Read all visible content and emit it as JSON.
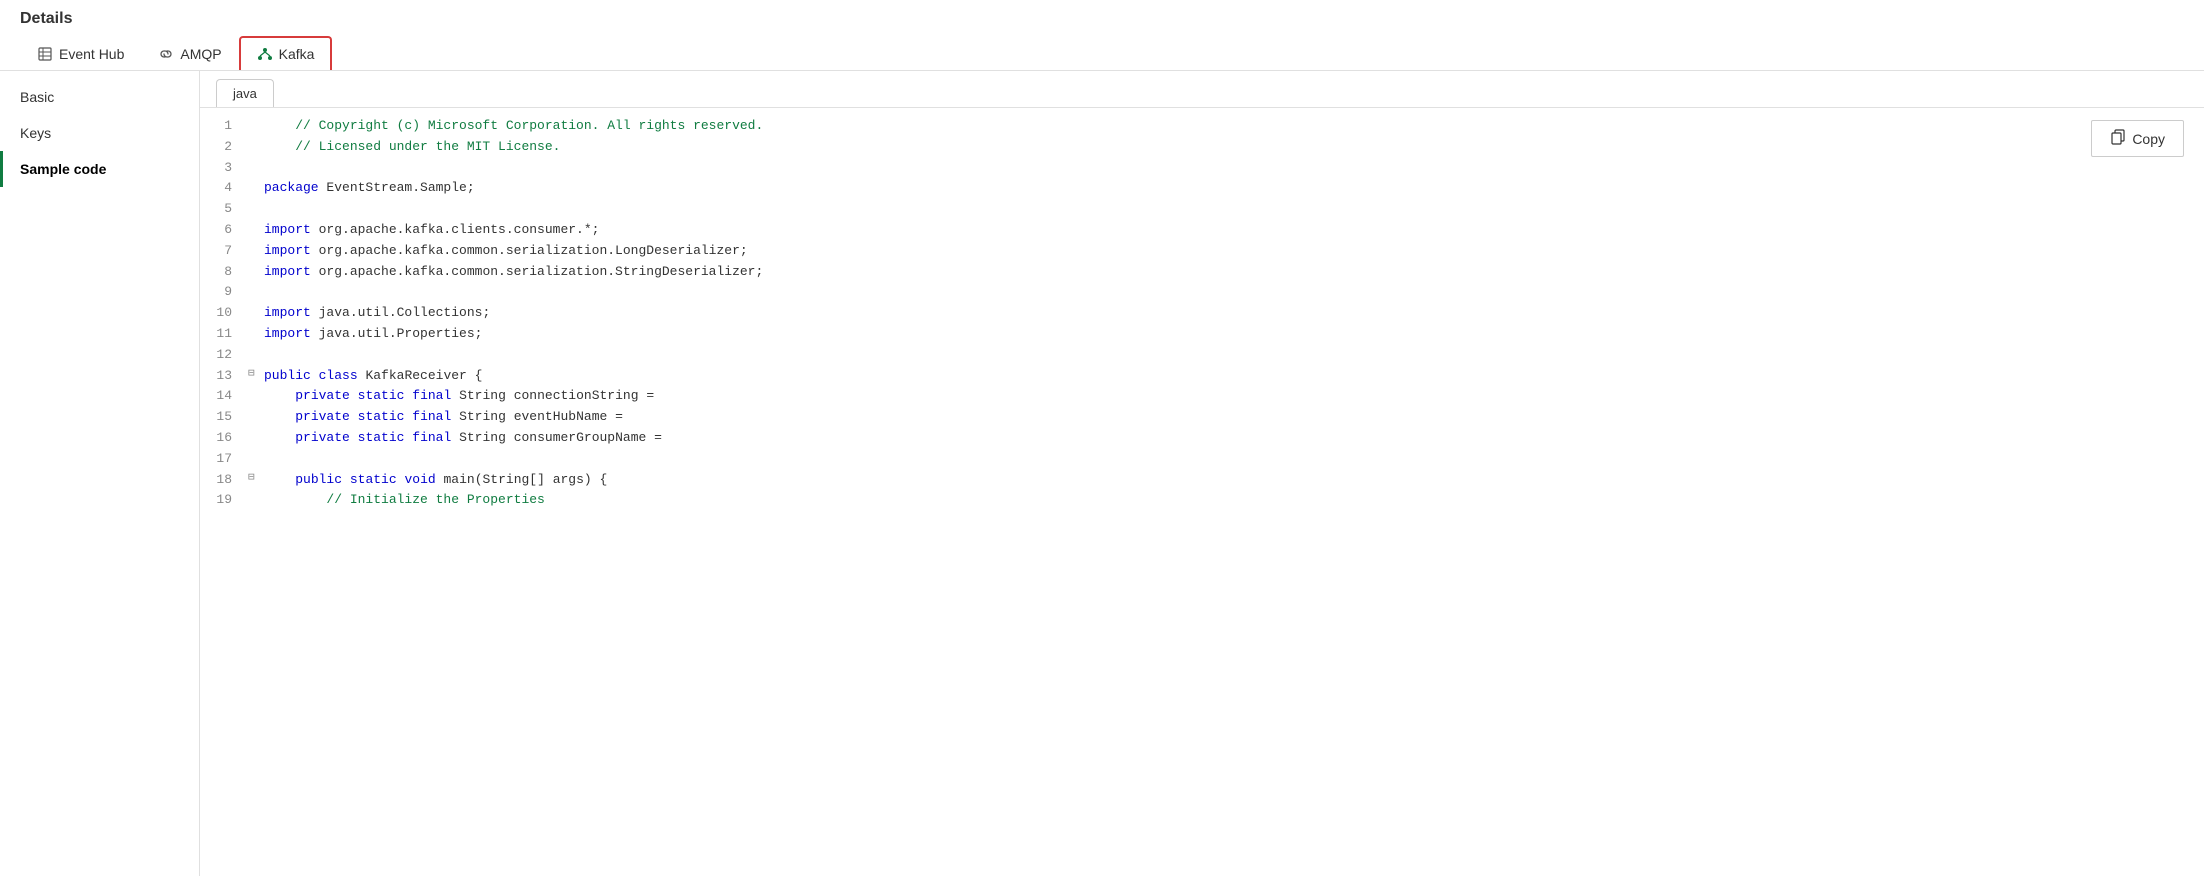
{
  "title": "Details",
  "tabs": [
    {
      "id": "event-hub",
      "label": "Event Hub",
      "icon": "table-icon",
      "active": false
    },
    {
      "id": "amqp",
      "label": "AMQP",
      "icon": "link-icon",
      "active": false
    },
    {
      "id": "kafka",
      "label": "Kafka",
      "icon": "kafka-icon",
      "active": true
    }
  ],
  "sidebar": {
    "items": [
      {
        "id": "basic",
        "label": "Basic",
        "active": false
      },
      {
        "id": "keys",
        "label": "Keys",
        "active": false
      },
      {
        "id": "sample-code",
        "label": "Sample code",
        "active": true
      }
    ]
  },
  "language_tabs": [
    {
      "id": "java",
      "label": "java",
      "active": true
    }
  ],
  "copy_button": "Copy",
  "code_lines": [
    {
      "num": 1,
      "content": "    // Copyright (c) Microsoft Corporation. All rights reserved.",
      "type": "comment"
    },
    {
      "num": 2,
      "content": "    // Licensed under the MIT License.",
      "type": "comment"
    },
    {
      "num": 3,
      "content": "",
      "type": "normal"
    },
    {
      "num": 4,
      "content": "    package EventStream.Sample;",
      "type": "mixed",
      "parts": [
        {
          "text": "    ",
          "class": ""
        },
        {
          "text": "package",
          "class": "kw-blue"
        },
        {
          "text": " EventStream.Sample;",
          "class": ""
        }
      ]
    },
    {
      "num": 5,
      "content": "",
      "type": "normal"
    },
    {
      "num": 6,
      "content": "    import org.apache.kafka.clients.consumer.*;",
      "type": "mixed",
      "parts": [
        {
          "text": "    ",
          "class": ""
        },
        {
          "text": "import",
          "class": "kw-blue"
        },
        {
          "text": " org.apache.kafka.clients.consumer.*;",
          "class": ""
        }
      ]
    },
    {
      "num": 7,
      "content": "    import org.apache.kafka.common.serialization.LongDeserializer;",
      "type": "mixed",
      "parts": [
        {
          "text": "    ",
          "class": ""
        },
        {
          "text": "import",
          "class": "kw-blue"
        },
        {
          "text": " org.apache.kafka.common.serialization.LongDeserializer;",
          "class": ""
        }
      ]
    },
    {
      "num": 8,
      "content": "    import org.apache.kafka.common.serialization.StringDeserializer;",
      "type": "mixed",
      "parts": [
        {
          "text": "    ",
          "class": ""
        },
        {
          "text": "import",
          "class": "kw-blue"
        },
        {
          "text": " org.apache.kafka.common.serialization.StringDeserializer;",
          "class": ""
        }
      ]
    },
    {
      "num": 9,
      "content": "",
      "type": "normal"
    },
    {
      "num": 10,
      "content": "    import java.util.Collections;",
      "type": "mixed",
      "parts": [
        {
          "text": "    ",
          "class": ""
        },
        {
          "text": "import",
          "class": "kw-blue"
        },
        {
          "text": " java.util.Collections;",
          "class": ""
        }
      ]
    },
    {
      "num": 11,
      "content": "    import java.util.Properties;",
      "type": "mixed",
      "parts": [
        {
          "text": "    ",
          "class": ""
        },
        {
          "text": "import",
          "class": "kw-blue"
        },
        {
          "text": " java.util.Properties;",
          "class": ""
        }
      ]
    },
    {
      "num": 12,
      "content": "",
      "type": "normal"
    },
    {
      "num": 13,
      "content": "    public class KafkaReceiver {",
      "type": "mixed",
      "foldable": true,
      "parts": [
        {
          "text": "    ",
          "class": ""
        },
        {
          "text": "public",
          "class": "kw-blue"
        },
        {
          "text": " ",
          "class": ""
        },
        {
          "text": "class",
          "class": "kw-blue"
        },
        {
          "text": " KafkaReceiver {",
          "class": ""
        }
      ]
    },
    {
      "num": 14,
      "content": "        private static final String connectionString =",
      "type": "mixed",
      "parts": [
        {
          "text": "        ",
          "class": ""
        },
        {
          "text": "private",
          "class": "kw-blue"
        },
        {
          "text": " ",
          "class": ""
        },
        {
          "text": "static",
          "class": "kw-blue"
        },
        {
          "text": " ",
          "class": ""
        },
        {
          "text": "final",
          "class": "kw-blue"
        },
        {
          "text": " String connectionString =",
          "class": ""
        }
      ]
    },
    {
      "num": 15,
      "content": "        private static final String eventHubName =",
      "type": "mixed",
      "parts": [
        {
          "text": "        ",
          "class": ""
        },
        {
          "text": "private",
          "class": "kw-blue"
        },
        {
          "text": " ",
          "class": ""
        },
        {
          "text": "static",
          "class": "kw-blue"
        },
        {
          "text": " ",
          "class": ""
        },
        {
          "text": "final",
          "class": "kw-blue"
        },
        {
          "text": " String eventHubName =",
          "class": ""
        }
      ]
    },
    {
      "num": 16,
      "content": "        private static final String consumerGroupName =",
      "type": "mixed",
      "parts": [
        {
          "text": "        ",
          "class": ""
        },
        {
          "text": "private",
          "class": "kw-blue"
        },
        {
          "text": " ",
          "class": ""
        },
        {
          "text": "static",
          "class": "kw-blue"
        },
        {
          "text": " ",
          "class": ""
        },
        {
          "text": "final",
          "class": "kw-blue"
        },
        {
          "text": " String consumerGroupName =",
          "class": ""
        }
      ]
    },
    {
      "num": 17,
      "content": "",
      "type": "normal"
    },
    {
      "num": 18,
      "content": "        public static void main(String[] args) {",
      "type": "mixed",
      "foldable": true,
      "parts": [
        {
          "text": "        ",
          "class": ""
        },
        {
          "text": "public",
          "class": "kw-blue"
        },
        {
          "text": " ",
          "class": ""
        },
        {
          "text": "static",
          "class": "kw-blue"
        },
        {
          "text": " ",
          "class": ""
        },
        {
          "text": "void",
          "class": "kw-blue"
        },
        {
          "text": " main(String[] args) {",
          "class": ""
        }
      ]
    },
    {
      "num": 19,
      "content": "            // Initialize the Properties",
      "type": "comment",
      "indent": "            "
    }
  ]
}
